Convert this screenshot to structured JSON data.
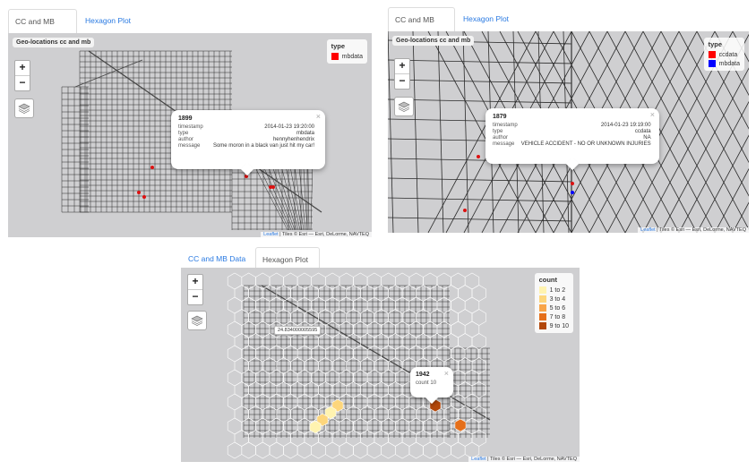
{
  "panels": [
    {
      "tabs": [
        {
          "label": "CC and MB Data",
          "active": true
        },
        {
          "label": "Hexagon Plot",
          "active": false
        }
      ],
      "map_title": "Geo-locations cc and mb",
      "zoom_in": "+",
      "zoom_out": "−",
      "legend": {
        "title": "type",
        "items": [
          {
            "label": "mbdata",
            "color": "#ff0000"
          }
        ]
      },
      "popup": {
        "id": "1899",
        "close": "×",
        "rows": [
          {
            "key": "timestamp",
            "value": "2014-01-23 19:20:00"
          },
          {
            "key": "type",
            "value": "mbdata"
          },
          {
            "key": "author",
            "value": "hennyhenhendrix"
          },
          {
            "key": "message",
            "value": "Some moron in a black van just hit my car!"
          }
        ]
      },
      "attribution": {
        "leaflet": "Leaflet",
        "tiles": " | Tiles © Esri — Esri, DeLorme, NAVTEQ"
      }
    },
    {
      "tabs": [
        {
          "label": "CC and MB Data",
          "active": true
        },
        {
          "label": "Hexagon Plot",
          "active": false
        }
      ],
      "map_title": "Geo-locations cc and mb",
      "zoom_in": "+",
      "zoom_out": "−",
      "legend": {
        "title": "type",
        "items": [
          {
            "label": "ccdata",
            "color": "#ff0000"
          },
          {
            "label": "mbdata",
            "color": "#0000ff"
          }
        ]
      },
      "popup": {
        "id": "1879",
        "close": "×",
        "rows": [
          {
            "key": "timestamp",
            "value": "2014-01-23 19:19:00"
          },
          {
            "key": "type",
            "value": "ccdata"
          },
          {
            "key": "author",
            "value": "NA"
          },
          {
            "key": "message",
            "value": "VEHICLE ACCIDENT - NO OR UNKNOWN INJURIES"
          }
        ]
      },
      "attribution": {
        "leaflet": "Leaflet",
        "tiles": " | Tiles © Esri — Esri, DeLorme, NAVTEQ"
      }
    },
    {
      "tabs": [
        {
          "label": "CC and MB Data",
          "active": false
        },
        {
          "label": "Hexagon Plot",
          "active": true
        }
      ],
      "zoom_in": "+",
      "zoom_out": "−",
      "legend": {
        "title": "count",
        "items": [
          {
            "label": "1 to 2",
            "color": "#fff3b0"
          },
          {
            "label": "3 to 4",
            "color": "#fdd67c"
          },
          {
            "label": "5 to 6",
            "color": "#f8a54a"
          },
          {
            "label": "7 to 8",
            "color": "#e56f1a"
          },
          {
            "label": "9 to 10",
            "color": "#b2470a"
          }
        ]
      },
      "hover_label": "24.834000005595",
      "popup": {
        "id": "1942",
        "close": "×",
        "count_label": "count",
        "count_value": "10"
      },
      "attribution": {
        "leaflet": "Leaflet",
        "tiles": " | Tiles © Esri — Esri, DeLorme, NAVTEQ"
      }
    }
  ]
}
